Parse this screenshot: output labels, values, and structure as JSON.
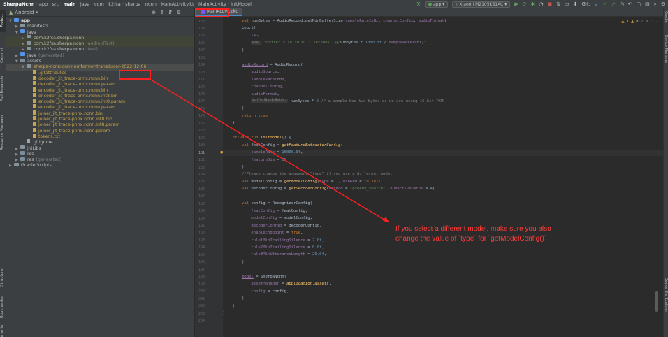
{
  "breadcrumb": [
    "SherpaNcnn",
    "app",
    "src",
    "main",
    "java",
    "com",
    "k2fsa",
    "sherpa",
    "ncnn",
    "MainActivity.kt",
    "MainActivity",
    "initModel"
  ],
  "toolbar": {
    "run_config": "app",
    "device": "Xiaomi M2105K81AC",
    "git_label": "Git:"
  },
  "project": {
    "view_label": "Android",
    "tree": [
      {
        "label": "app",
        "depth": 0,
        "kind": "folder-blue",
        "arrow": "open",
        "style": "white"
      },
      {
        "label": "manifests",
        "depth": 1,
        "kind": "folder",
        "arrow": "closed"
      },
      {
        "label": "java",
        "depth": 1,
        "kind": "folder-blue",
        "arrow": "open"
      },
      {
        "label": "com.k2fsa.sherpa.ncnn",
        "depth": 2,
        "kind": "pkg",
        "arrow": "closed",
        "style": "hl"
      },
      {
        "label": "com.k2fsa.sherpa.ncnn",
        "suffix": "(androidTest)",
        "depth": 2,
        "kind": "pkg",
        "arrow": "closed",
        "style": "hl"
      },
      {
        "label": "com.k2fsa.sherpa.ncnn",
        "suffix": "(test)",
        "depth": 2,
        "kind": "pkg",
        "arrow": "closed"
      },
      {
        "label": "java",
        "suffix": "(generated)",
        "depth": 1,
        "kind": "folder-blue",
        "arrow": "closed"
      },
      {
        "label": "assets",
        "depth": 1,
        "kind": "folder-res",
        "arrow": "open"
      },
      {
        "label": "sherpa-ncnn-conv-emformer-transducer-2022-12-06",
        "depth": 2,
        "kind": "folder",
        "arrow": "open",
        "style": "yellow",
        "selected": true
      },
      {
        "label": ".gitattributes",
        "depth": 3,
        "kind": "file-y",
        "style": "yellow"
      },
      {
        "label": "decoder_jit_trace-pnnx.ncnn.bin",
        "depth": 3,
        "kind": "file-y",
        "style": "yellow"
      },
      {
        "label": "decoder_jit_trace-pnnx.ncnn.param",
        "depth": 3,
        "kind": "file-y",
        "style": "yellow"
      },
      {
        "label": "encoder_jit_trace-pnnx.ncnn.bin",
        "depth": 3,
        "kind": "file-y",
        "style": "yellow"
      },
      {
        "label": "encoder_jit_trace-pnnx.ncnn.int8.bin",
        "depth": 3,
        "kind": "file-y",
        "style": "yellow"
      },
      {
        "label": "encoder_jit_trace-pnnx.ncnn.int8.param",
        "depth": 3,
        "kind": "file-y",
        "style": "yellow"
      },
      {
        "label": "encoder_jit_trace-pnnx.ncnn.param",
        "depth": 3,
        "kind": "file-y",
        "style": "yellow"
      },
      {
        "label": "joiner_jit_trace-pnnx.ncnn.bin",
        "depth": 3,
        "kind": "file-y",
        "style": "yellow"
      },
      {
        "label": "joiner_jit_trace-pnnx.ncnn.int8.bin",
        "depth": 3,
        "kind": "file-y",
        "style": "yellow"
      },
      {
        "label": "joiner_jit_trace-pnnx.ncnn.int8.param",
        "depth": 3,
        "kind": "file-y",
        "style": "yellow"
      },
      {
        "label": "joiner_jit_trace-pnnx.ncnn.param",
        "depth": 3,
        "kind": "file-y",
        "style": "yellow"
      },
      {
        "label": "tokens.txt",
        "depth": 3,
        "kind": "file-y",
        "style": "yellow"
      },
      {
        "label": ".gitignore",
        "depth": 2,
        "kind": "file"
      },
      {
        "label": "jniLibs",
        "depth": 1,
        "kind": "folder",
        "arrow": "closed"
      },
      {
        "label": "res",
        "depth": 1,
        "kind": "folder-res",
        "arrow": "closed"
      },
      {
        "label": "res",
        "suffix": "(generated)",
        "depth": 1,
        "kind": "folder-res",
        "arrow": "closed"
      },
      {
        "label": "Gradle Scripts",
        "depth": 0,
        "kind": "folder",
        "arrow": "closed"
      }
    ]
  },
  "editor": {
    "tab": "MainActivity.kt",
    "inspections": {
      "warnings": "1",
      "weak": "8",
      "ok": "1"
    },
    "current_line": 181,
    "lines": [
      {
        "n": 163,
        "t": [
          [
            "",
            "        "
          ],
          [
            "kw",
            "val "
          ],
          [
            "",
            "numBytes = AudioRecord.getMinBufferSize("
          ],
          [
            "pr",
            "sampleRateInHz"
          ],
          [
            "",
            ", "
          ],
          [
            "pr",
            "channelConfig"
          ],
          [
            "",
            ", "
          ],
          [
            "pr",
            "audioFormat"
          ],
          [
            "",
            ")"
          ]
        ]
      },
      {
        "n": 164,
        "t": [
          [
            "",
            "        Log.i("
          ]
        ]
      },
      {
        "n": 165,
        "t": [
          [
            "",
            "            "
          ],
          [
            "pr",
            "TAG"
          ],
          [
            "",
            ","
          ]
        ]
      },
      {
        "n": 166,
        "t": [
          [
            "",
            "            "
          ],
          [
            "hint",
            "msg:"
          ],
          [
            "str",
            " \"buffer size in milliseconds: ${"
          ],
          [
            "",
            "numBytes * "
          ],
          [
            "num",
            "1000.0f"
          ],
          [
            "",
            " / "
          ],
          [
            "pr",
            "sampleRateInHz"
          ],
          [
            "str",
            "}\""
          ]
        ]
      },
      {
        "n": 167,
        "t": [
          [
            "",
            "        )"
          ]
        ]
      },
      {
        "n": 168,
        "t": []
      },
      {
        "n": 169,
        "t": [
          [
            "",
            "        "
          ],
          [
            "pru",
            "audioRecord"
          ],
          [
            "",
            " = AudioRecord("
          ]
        ]
      },
      {
        "n": 170,
        "t": [
          [
            "",
            "            "
          ],
          [
            "pr",
            "audioSource"
          ],
          [
            "",
            ","
          ]
        ]
      },
      {
        "n": 171,
        "t": [
          [
            "",
            "            "
          ],
          [
            "pr",
            "sampleRateInHz"
          ],
          [
            "",
            ","
          ]
        ]
      },
      {
        "n": 172,
        "t": [
          [
            "",
            "            "
          ],
          [
            "pr",
            "channelConfig"
          ],
          [
            "",
            ","
          ]
        ]
      },
      {
        "n": 173,
        "t": [
          [
            "",
            "            "
          ],
          [
            "pr",
            "audioFormat"
          ],
          [
            "",
            ","
          ]
        ]
      },
      {
        "n": 174,
        "t": [
          [
            "",
            "            "
          ],
          [
            "hint",
            "bufferSizeInBytes:"
          ],
          [
            "",
            " numBytes * "
          ],
          [
            "num",
            "2"
          ],
          [
            "cm",
            " // a sample has two bytes as we are using 16-bit PCM"
          ]
        ]
      },
      {
        "n": 175,
        "t": [
          [
            "",
            "        )"
          ]
        ]
      },
      {
        "n": 176,
        "t": [
          [
            "",
            "        "
          ],
          [
            "kw",
            "return true"
          ]
        ]
      },
      {
        "n": 177,
        "t": [
          [
            "",
            "    }"
          ]
        ]
      },
      {
        "n": 178,
        "t": []
      },
      {
        "n": 179,
        "t": [
          [
            "",
            "    "
          ],
          [
            "kw",
            "private fun "
          ],
          [
            "fn",
            "initModel"
          ],
          [
            "",
            "() {"
          ]
        ]
      },
      {
        "n": 180,
        "t": [
          [
            "",
            "        "
          ],
          [
            "kw",
            "val "
          ],
          [
            "",
            "featConfig = "
          ],
          [
            "it",
            "getFeatureExtractorConfig"
          ],
          [
            "",
            "("
          ]
        ]
      },
      {
        "n": 181,
        "t": [
          [
            "",
            "            "
          ],
          [
            "pr",
            "sampleRate"
          ],
          [
            "",
            " = "
          ],
          [
            "num",
            "16000.0f"
          ],
          [
            "",
            ","
          ]
        ]
      },
      {
        "n": 182,
        "t": [
          [
            "",
            "            "
          ],
          [
            "pr",
            "featureDim"
          ],
          [
            "",
            " = "
          ],
          [
            "num",
            "80"
          ]
        ]
      },
      {
        "n": 183,
        "t": [
          [
            "",
            "        )"
          ]
        ]
      },
      {
        "n": 184,
        "t": [
          [
            "cm",
            "        //Please change the argument \"type\" if you use a different model"
          ]
        ]
      },
      {
        "n": 185,
        "t": [
          [
            "",
            "        "
          ],
          [
            "kw",
            "val "
          ],
          [
            "",
            "modelConfig = "
          ],
          [
            "it",
            "getModelConfig"
          ],
          [
            "",
            "("
          ],
          [
            "pr",
            "type"
          ],
          [
            "",
            " = "
          ],
          [
            "num",
            "1"
          ],
          [
            "",
            ", "
          ],
          [
            "pr",
            "useGPU"
          ],
          [
            "",
            " = "
          ],
          [
            "kw",
            "false"
          ],
          [
            "",
            ")!!"
          ]
        ]
      },
      {
        "n": 186,
        "t": [
          [
            "",
            "        "
          ],
          [
            "kw",
            "val "
          ],
          [
            "",
            "decoderConfig = "
          ],
          [
            "it",
            "getDecoderConfig"
          ],
          [
            "",
            "("
          ],
          [
            "pr",
            "method"
          ],
          [
            "",
            " = "
          ],
          [
            "str",
            "\"greedy_search\""
          ],
          [
            "",
            ", "
          ],
          [
            "pr",
            "numActivePaths"
          ],
          [
            "",
            " = "
          ],
          [
            "num",
            "4"
          ],
          [
            "",
            ")"
          ]
        ]
      },
      {
        "n": 187,
        "t": []
      },
      {
        "n": 188,
        "t": [
          [
            "",
            "        "
          ],
          [
            "kw",
            "val "
          ],
          [
            "",
            "config = RecognizerConfig("
          ]
        ]
      },
      {
        "n": 189,
        "t": [
          [
            "",
            "            "
          ],
          [
            "pr",
            "featConfig"
          ],
          [
            "",
            " = featConfig,"
          ]
        ]
      },
      {
        "n": 190,
        "t": [
          [
            "",
            "            "
          ],
          [
            "pr",
            "modelConfig"
          ],
          [
            "",
            " = modelConfig,"
          ]
        ]
      },
      {
        "n": 191,
        "t": [
          [
            "",
            "            "
          ],
          [
            "pr",
            "decoderConfig"
          ],
          [
            "",
            " = decoderConfig,"
          ]
        ]
      },
      {
        "n": 192,
        "t": [
          [
            "",
            "            "
          ],
          [
            "pr",
            "enableEndpoint"
          ],
          [
            "",
            " = "
          ],
          [
            "kw",
            "true"
          ],
          [
            "",
            ","
          ]
        ]
      },
      {
        "n": 193,
        "t": [
          [
            "",
            "            "
          ],
          [
            "pr",
            "rule1MinTrailingSilence"
          ],
          [
            "",
            " = "
          ],
          [
            "num",
            "2.0f"
          ],
          [
            "",
            ","
          ]
        ]
      },
      {
        "n": 194,
        "t": [
          [
            "",
            "            "
          ],
          [
            "pr",
            "rule2MinTrailingSilence"
          ],
          [
            "",
            " = "
          ],
          [
            "num",
            "0.8f"
          ],
          [
            "",
            ","
          ]
        ]
      },
      {
        "n": 195,
        "t": [
          [
            "",
            "            "
          ],
          [
            "pr",
            "rule3MinUtteranceLength"
          ],
          [
            "",
            " = "
          ],
          [
            "num",
            "20.0f"
          ],
          [
            "",
            ","
          ]
        ]
      },
      {
        "n": 196,
        "t": [
          [
            "",
            "        )"
          ]
        ]
      },
      {
        "n": 197,
        "t": []
      },
      {
        "n": 198,
        "t": [
          [
            "",
            "        "
          ],
          [
            "pru",
            "model"
          ],
          [
            "",
            " = SherpaNcnn("
          ]
        ]
      },
      {
        "n": 199,
        "t": [
          [
            "",
            "            "
          ],
          [
            "pr",
            "assetManager"
          ],
          [
            "",
            " = "
          ],
          [
            "it",
            "application"
          ],
          [
            "",
            "."
          ],
          [
            "it",
            "assets"
          ],
          [
            "",
            ","
          ]
        ]
      },
      {
        "n": 200,
        "t": [
          [
            "",
            "            "
          ],
          [
            "pr",
            "config"
          ],
          [
            "",
            " = config,"
          ]
        ]
      },
      {
        "n": 201,
        "t": [
          [
            "",
            "        )"
          ]
        ]
      },
      {
        "n": 202,
        "t": [
          [
            "",
            "    }"
          ]
        ]
      },
      {
        "n": 203,
        "t": [
          [
            "",
            "}"
          ]
        ]
      },
      {
        "n": 204,
        "t": []
      }
    ]
  },
  "left_tool_tabs": [
    "Project",
    "Commit",
    "Pull Requests",
    "Resource Manager",
    "Structure",
    "Bookmarks",
    "Variants"
  ],
  "right_tool_tabs": [
    "Gradle",
    "Device Manager",
    "Device File Explorer"
  ],
  "annotation": {
    "line1": "If you select a different model, make sure you also",
    "line2": "change the value of `type` for `getModelConfig()`"
  },
  "colors": {
    "annotation_red": "#ff2020",
    "editor_bg": "#2b2b2b",
    "panel_bg": "#3c3f41"
  }
}
